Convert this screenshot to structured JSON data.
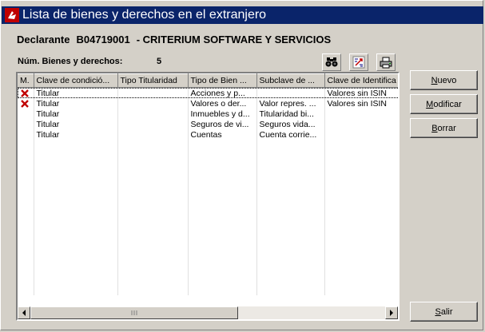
{
  "window": {
    "title": "Lista de bienes y derechos en el extranjero"
  },
  "declarante": {
    "label": "Declarante",
    "code": "B04719001",
    "name": "- CRITERIUM SOFTWARE Y SERVICIOS"
  },
  "summary": {
    "count_label": "Núm. Bienes y derechos:",
    "count_value": "5"
  },
  "toolbar": {
    "icons": [
      "binoculars-icon",
      "export-icon",
      "print-icon"
    ]
  },
  "table": {
    "columns": [
      "M.",
      "Clave de condició...",
      "Tipo Titularidad",
      "Tipo de Bien ...",
      "Subclave de ...",
      "Clave de Identifica"
    ],
    "rows": [
      {
        "mark": true,
        "cells": [
          "Titular",
          "",
          "Acciones y p...",
          "",
          "Valores sin ISIN"
        ]
      },
      {
        "mark": true,
        "cells": [
          "Titular",
          "",
          "Valores o der...",
          "Valor repres. ...",
          "Valores sin ISIN"
        ]
      },
      {
        "mark": false,
        "cells": [
          "Titular",
          "",
          "Inmuebles y d...",
          "Titularidad bi...",
          ""
        ]
      },
      {
        "mark": false,
        "cells": [
          "Titular",
          "",
          "Seguros de vi...",
          "Seguros vida...",
          ""
        ]
      },
      {
        "mark": false,
        "cells": [
          "Titular",
          "",
          "Cuentas",
          "Cuenta corrie...",
          ""
        ]
      }
    ]
  },
  "buttons": {
    "nuevo_key": "N",
    "nuevo_rest": "uevo",
    "modificar_key": "M",
    "modificar_rest": "odificar",
    "borrar_key": "B",
    "borrar_rest": "orrar",
    "salir_key": "S",
    "salir_rest": "alir"
  },
  "colors": {
    "titlebar": "#0a246a",
    "mark": "#c00000",
    "face": "#d4d0c8"
  }
}
